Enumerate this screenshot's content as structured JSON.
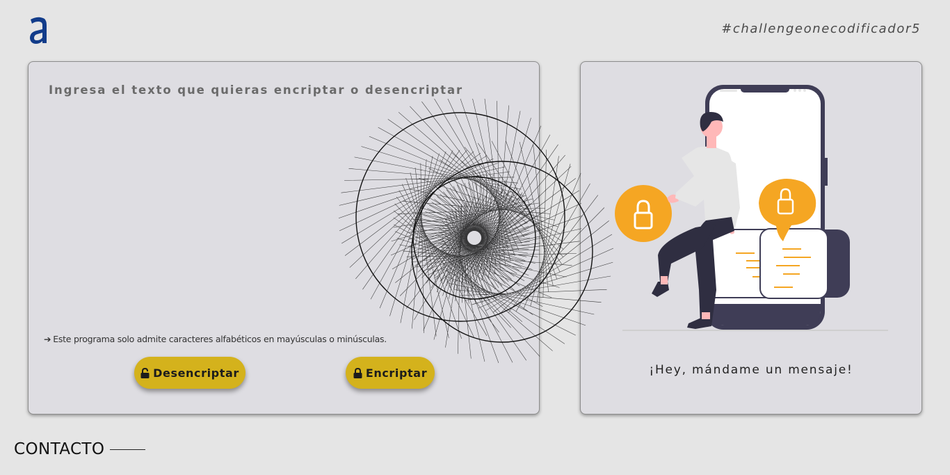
{
  "header": {
    "logo_icon": "alura-a-logo",
    "hashtag": "#challengeonecodificador5"
  },
  "main": {
    "prompt": "Ingresa el texto que quieras encriptar o desencriptar",
    "input_value": "",
    "note": "Este programa solo admite caracteres alfabéticos en mayúsculas o minúsculas.",
    "note_icon": "arrow-right-icon",
    "buttons": {
      "decrypt_label": "Desencriptar",
      "decrypt_icon": "lock-open-icon",
      "encrypt_label": "Encriptar",
      "encrypt_icon": "lock-icon"
    }
  },
  "side": {
    "message": "¡Hey, mándame un mensaje!"
  },
  "footer": {
    "contact_label": "CONTACTO"
  },
  "colors": {
    "background": "#e5e5e5",
    "card": "#dedde2",
    "button": "#d4b21c",
    "accent_orange": "#f5a623",
    "logo_blue": "#123c8a",
    "phone_dark": "#3f3d56"
  }
}
